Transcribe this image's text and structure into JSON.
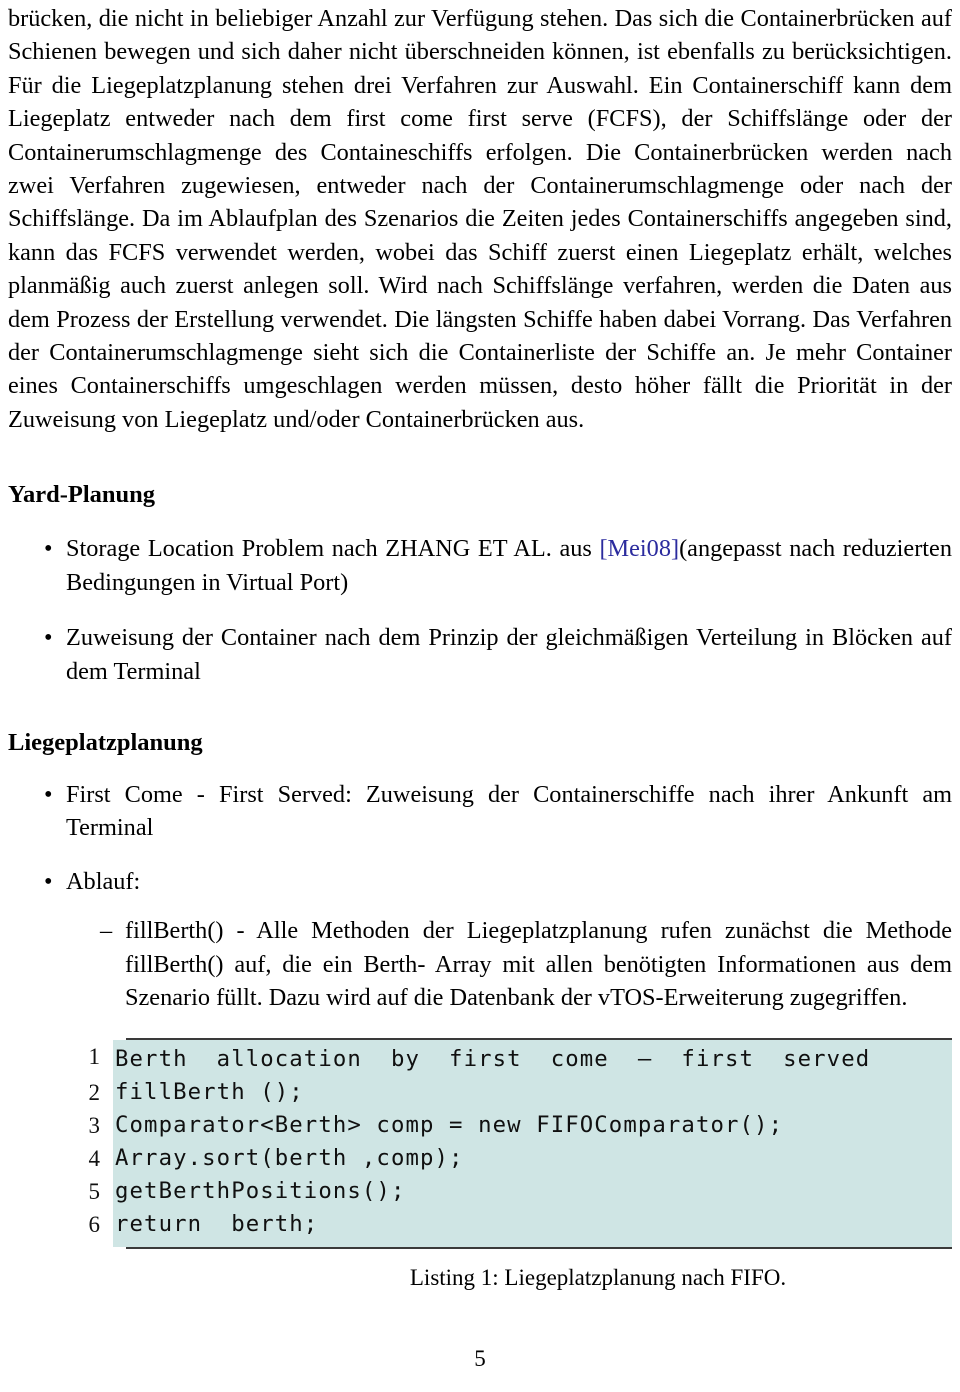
{
  "document": {
    "page_number": "5",
    "link_color": "#2b2b9e",
    "code_background": "#cfe5e4"
  },
  "body": {
    "paragraph_1": "brücken, die nicht in beliebiger Anzahl zur Verfügung stehen. Das sich die Containerbrücken auf Schienen bewegen und sich daher nicht überschneiden können, ist ebenfalls zu berücksichtigen. Für die Liegeplatzplanung stehen drei Verfahren zur Auswahl. Ein Containerschiff kann dem Liegeplatz entweder nach dem first come first serve (FCFS), der Schiffslänge oder der Containerumschlagmenge des Containeschiffs erfolgen. Die Containerbrücken werden nach zwei Verfahren zugewiesen, entweder nach der Containerumschlagmenge oder nach der Schiffslänge. Da im Ablaufplan des Szenarios die Zeiten jedes Containerschiffs angegeben sind, kann das FCFS verwendet werden, wobei das Schiff zuerst einen Liegeplatz erhält, welches planmäßig auch zuerst anlegen soll. Wird nach Schiffslänge verfahren, werden die Daten aus dem Prozess der Erstellung verwendet. Die längsten Schiffe haben dabei Vorrang. Das Verfahren der Containerumschlagmenge sieht sich die Containerliste der Schiffe an. Je mehr Container eines Containerschiffs umgeschlagen werden müssen, desto höher fällt die Priorität in der Zuweisung von Liegeplatz und/oder Containerbrücken aus."
  },
  "sections": [
    {
      "heading": "Yard-Planung",
      "items": [
        {
          "bullet": "•",
          "text_before_link": "Storage Location Problem nach ZHANG ET AL. aus ",
          "link": "[Mei08]",
          "text_after_link": "(angepasst nach reduzierten Bedingungen in Virtual Port)"
        },
        {
          "bullet": "•",
          "text": "Zuweisung der Container nach dem Prinzip der gleichmäßigen Verteilung in Blöcken auf dem Terminal"
        }
      ]
    },
    {
      "heading": "Liegeplatzplanung",
      "items": [
        {
          "bullet": "•",
          "text": "First Come - First Served: Zuweisung der Containerschiffe nach ihrer Ankunft am Terminal"
        },
        {
          "bullet": "•",
          "text": "Ablauf:"
        }
      ],
      "subitems": [
        {
          "dash": "–",
          "text": "fillBerth() - Alle Methoden der Liegeplatzplanung rufen zunächst die Methode fillBerth() auf, die ein Berth- Array mit allen benötigten Informationen aus dem Szenario füllt. Dazu wird auf die Datenbank der vTOS-Erweiterung zugegriffen."
        }
      ]
    }
  ],
  "listing": {
    "caption": "Listing 1: Liegeplatzplanung nach FIFO.",
    "lines": [
      {
        "number": "1",
        "code": "Berth  allocation  by  first  come  –  first  served"
      },
      {
        "number": "2",
        "code": "fillBerth ();"
      },
      {
        "number": "3",
        "code": "Comparator<Berth> comp = new FIFOComparator();"
      },
      {
        "number": "4",
        "code": "Array.sort(berth ,comp);"
      },
      {
        "number": "5",
        "code": "getBerthPositions();"
      },
      {
        "number": "6",
        "code": "return  berth;"
      }
    ]
  }
}
